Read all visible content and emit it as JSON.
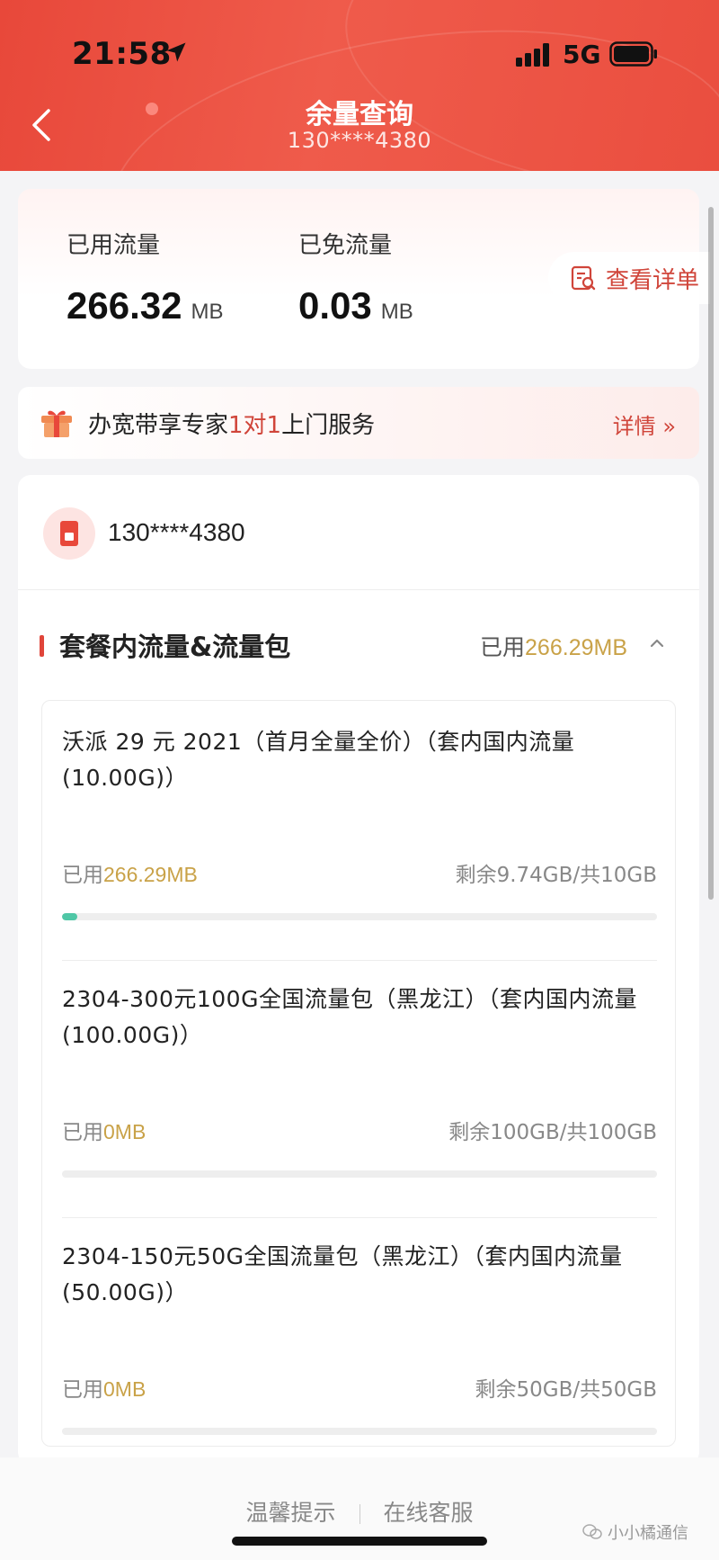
{
  "status_bar": {
    "time": "21:58",
    "network": "5G"
  },
  "header": {
    "title": "余量查询",
    "subtitle": "130****4380"
  },
  "usage": {
    "used_label": "已用流量",
    "used_value": "266.32",
    "used_unit": "MB",
    "free_label": "已免流量",
    "free_value": "0.03",
    "free_unit": "MB",
    "detail_label": "查看详单"
  },
  "promo": {
    "text_before": "办宽带享专家",
    "text_highlight": "1对1",
    "text_after": "上门服务",
    "more_label": "详情 »"
  },
  "account": {
    "phone": "130****4380"
  },
  "section": {
    "title": "套餐内流量&流量包",
    "used_prefix": "已用",
    "used_value": "266.29MB"
  },
  "packages": [
    {
      "name": "沃派 29 元 2021（首月全量全价）（套内国内流量(10.00G)）",
      "used_prefix": "已用",
      "used_value": "266.29MB",
      "remaining": "剩余9.74GB/共10GB",
      "progress": 0.026
    },
    {
      "name": "2304-300元100G全国流量包（黑龙江）（套内国内流量(100.00G)）",
      "used_prefix": "已用",
      "used_value": "0MB",
      "remaining": "剩余100GB/共100GB",
      "progress": 0
    },
    {
      "name": "2304-150元50G全国流量包（黑龙江）（套内国内流量(50.00G)）",
      "used_prefix": "已用",
      "used_value": "0MB",
      "remaining": "剩余50GB/共50GB",
      "progress": 0
    }
  ],
  "footer": {
    "tips": "温馨提示",
    "service": "在线客服"
  },
  "watermark": "小小橘通信",
  "colors": {
    "brand_red": "#e8483a",
    "gold": "#c9a248",
    "progress": "#4fc7a6"
  }
}
